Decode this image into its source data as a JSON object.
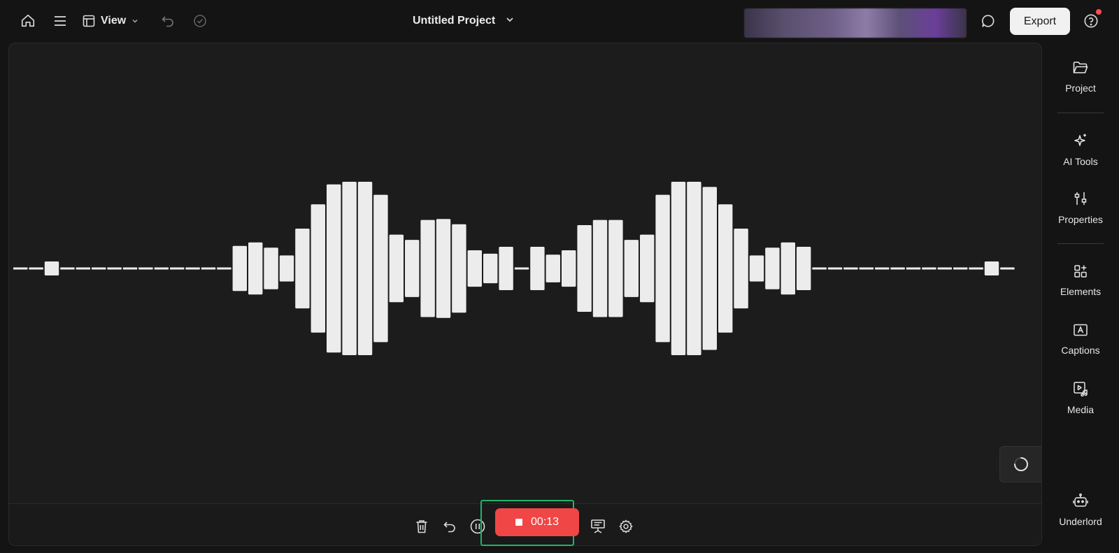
{
  "topbar": {
    "view_label": "View",
    "project_title": "Untitled Project",
    "export_label": "Export",
    "icons": {
      "home": "home-icon",
      "menu": "menu-icon",
      "view": "layout-icon",
      "undo": "undo-icon",
      "saved": "check-circle-icon",
      "title_dropdown": "chevron-down-icon",
      "comments": "chat-bubble-icon",
      "help": "help-icon"
    }
  },
  "recorder": {
    "timer": "00:13",
    "record_color": "#f04646",
    "focus_color": "#1db46a",
    "icons": [
      "trash-icon",
      "undo-icon",
      "pause-icon",
      "stop-icon",
      "teleprompter-icon",
      "gear-icon"
    ]
  },
  "sidebar": {
    "items": [
      {
        "label": "Project",
        "icon": "folder-icon"
      },
      {
        "label": "AI Tools",
        "icon": "sparkle-icon"
      },
      {
        "label": "Properties",
        "icon": "sliders-icon"
      },
      {
        "label": "Elements",
        "icon": "elements-icon"
      },
      {
        "label": "Captions",
        "icon": "captions-icon"
      },
      {
        "label": "Media",
        "icon": "media-icon"
      },
      {
        "label": "Underlord",
        "icon": "robot-icon"
      }
    ]
  },
  "waveform": {
    "color": "#ececec",
    "levels": [
      0,
      0,
      0.08,
      0,
      0,
      0,
      0,
      0,
      0,
      0,
      0,
      0,
      0,
      0,
      0.26,
      0.3,
      0.24,
      0.15,
      0.46,
      0.74,
      0.97,
      1.0,
      1.0,
      0.85,
      0.39,
      0.33,
      0.56,
      0.57,
      0.51,
      0.21,
      0.17,
      0.25,
      0,
      0.25,
      0.16,
      0.21,
      0.5,
      0.56,
      0.56,
      0.33,
      0.39,
      0.85,
      1.0,
      1.0,
      0.94,
      0.74,
      0.46,
      0.15,
      0.24,
      0.3,
      0.25,
      0,
      0,
      0,
      0,
      0,
      0,
      0,
      0,
      0,
      0,
      0,
      0.08,
      0
    ]
  }
}
